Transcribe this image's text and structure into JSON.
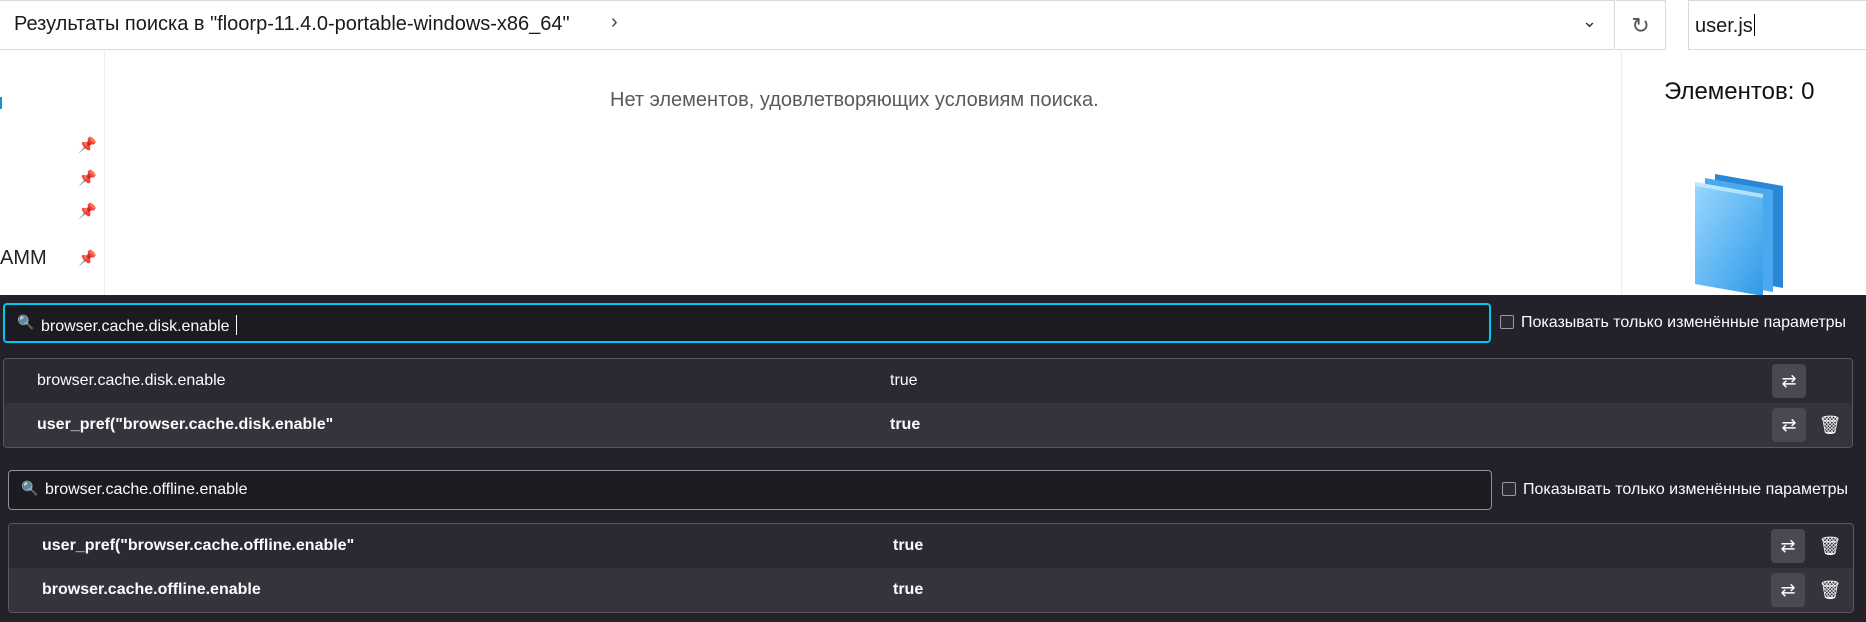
{
  "explorer": {
    "address": "Результаты поиска в \"floorp-11.4.0-portable-windows-x86_64\"",
    "address_separator": "›",
    "address_dropdown": "⌄",
    "refresh_icon": "↻",
    "search_value": "user.js",
    "nav_partial_label": "AMM",
    "empty_message": "Нет элементов, удовлетворяющих условиям поиска.",
    "item_count": "Элементов: 0",
    "pin_icon": "📌"
  },
  "config_panels": [
    {
      "filter_value": "browser.cache.disk.enable",
      "filter_active": true,
      "checkbox_label": "Показывать только изменённые параметры",
      "rows": [
        {
          "name": "browser.cache.disk.enable",
          "value": "true",
          "bold": false,
          "deletable": false
        },
        {
          "name": "user_pref(\"browser.cache.disk.enable\"",
          "value": "true",
          "bold": true,
          "deletable": true
        }
      ]
    },
    {
      "filter_value": "browser.cache.offline.enable",
      "filter_active": false,
      "checkbox_label": "Показывать только изменённые параметры",
      "rows": [
        {
          "name": "user_pref(\"browser.cache.offline.enable\"",
          "value": "true",
          "bold": true,
          "deletable": true
        },
        {
          "name": "browser.cache.offline.enable",
          "value": "true",
          "bold": true,
          "deletable": true
        }
      ]
    }
  ],
  "icons": {
    "search": "🔍",
    "toggle": "⇄",
    "delete": "🗑"
  },
  "colors": {
    "config_bg": "#23222b",
    "focus_accent": "#00c8f0",
    "explorer_accent": "#1a8fd6"
  }
}
